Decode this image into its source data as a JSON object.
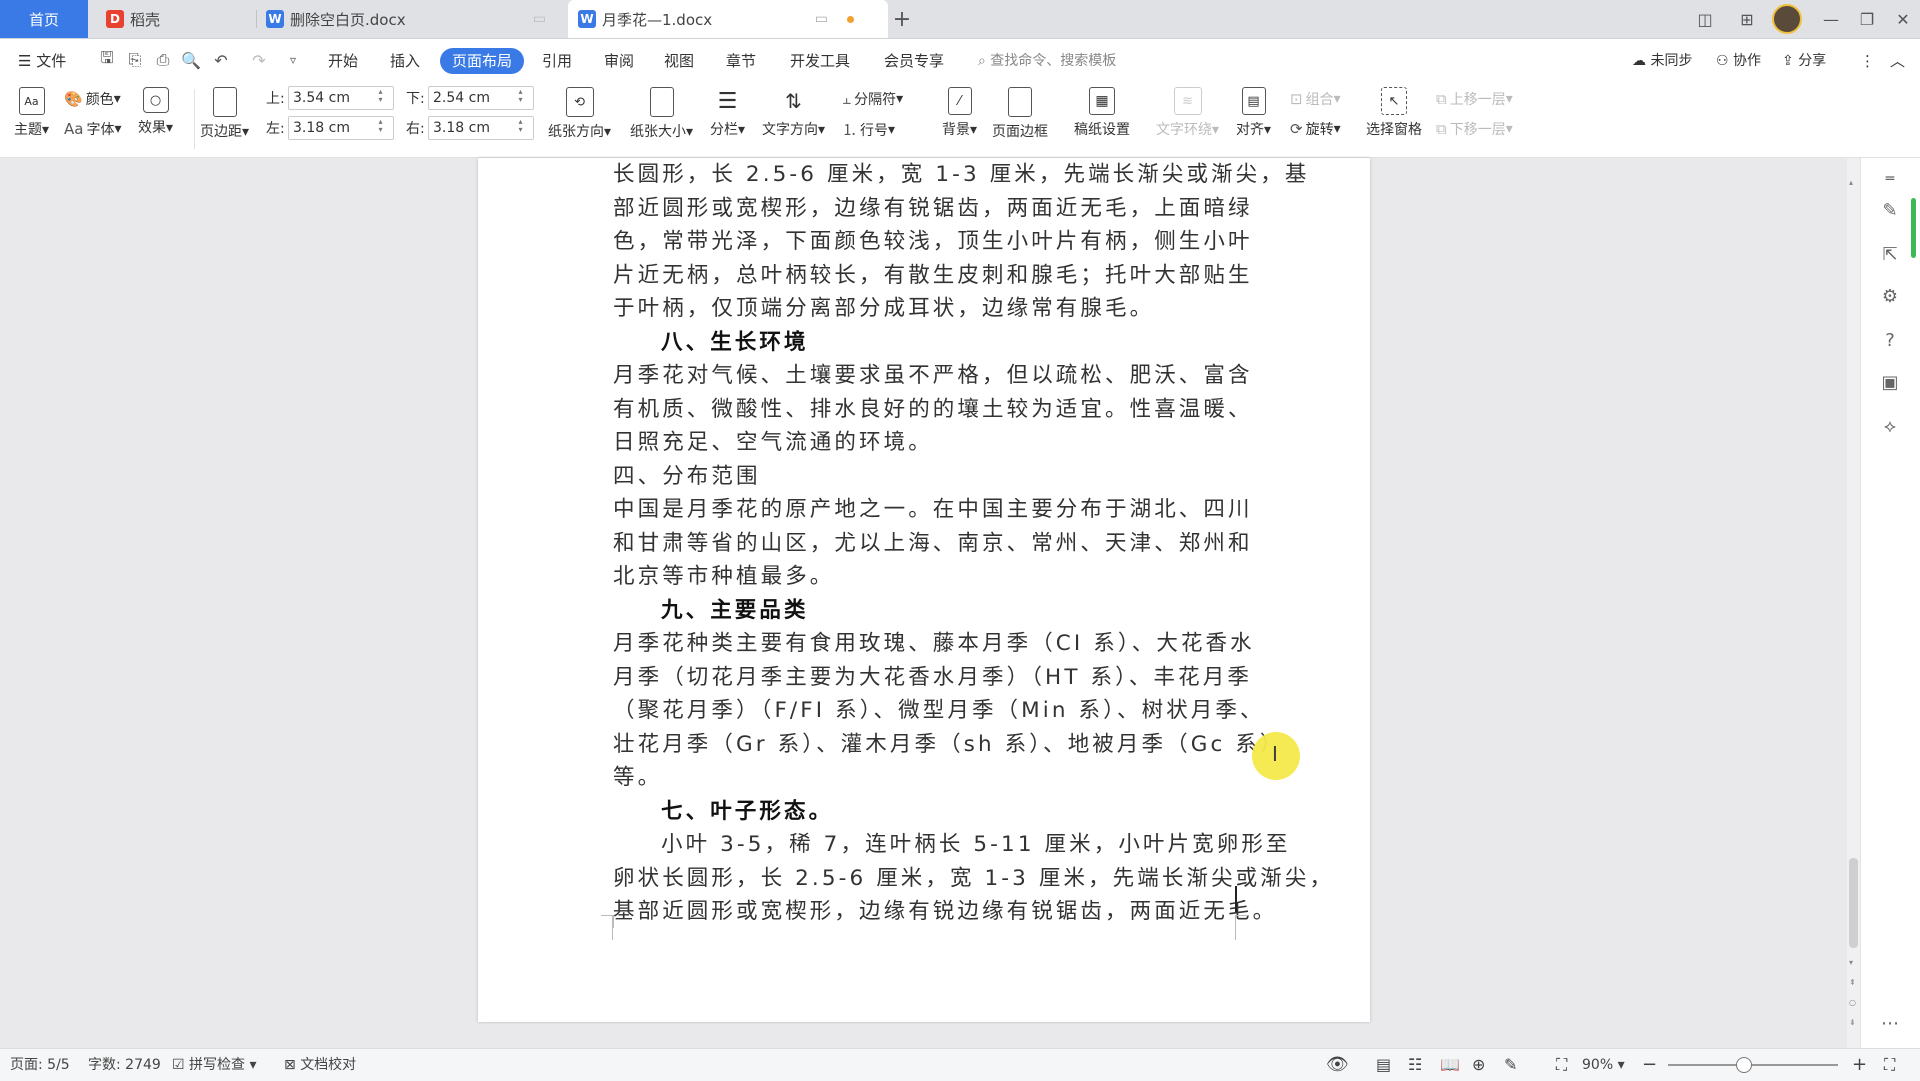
{
  "tabs": {
    "home": "首页",
    "daoke": "稻壳",
    "doc1": "删除空白页.docx",
    "doc2": "月季花—1.docx",
    "add": "+"
  },
  "menu": {
    "file": "文件",
    "items": [
      "开始",
      "插入",
      "页面布局",
      "引用",
      "审阅",
      "视图",
      "章节",
      "开发工具",
      "会员专享"
    ],
    "search_placeholder": "查找命令、搜索模板",
    "sync": "未同步",
    "collab": "协作",
    "share": "分享"
  },
  "ribbon": {
    "theme": "主题",
    "color": "颜色",
    "font": "字体",
    "effect": "效果",
    "margins": "页边距",
    "top_label": "上:",
    "top_value": "3.54 cm",
    "bottom_label": "下:",
    "bottom_value": "2.54 cm",
    "left_label": "左:",
    "left_value": "3.18 cm",
    "right_label": "右:",
    "right_value": "3.18 cm",
    "orientation": "纸张方向",
    "size": "纸张大小",
    "columns": "分栏",
    "text_direction": "文字方向",
    "breaks": "分隔符",
    "line_numbers": "行号",
    "background": "背景",
    "page_border": "页面边框",
    "manuscript": "稿纸设置",
    "wrap": "文字环绕",
    "align": "对齐",
    "group": "组合",
    "rotate": "旋转",
    "selection_pane": "选择窗格",
    "bring_forward": "上移一层",
    "send_backward": "下移一层"
  },
  "document": {
    "lines": [
      {
        "t": "长圆形，长 2.5-6 厘米，宽 1-3 厘米，先端长渐尖或渐尖，基",
        "cls": ""
      },
      {
        "t": "部近圆形或宽楔形，边缘有锐锯齿，两面近无毛，上面暗绿",
        "cls": ""
      },
      {
        "t": "色，常带光泽，下面颜色较浅，顶生小叶片有柄，侧生小叶",
        "cls": ""
      },
      {
        "t": "片近无柄，总叶柄较长，有散生皮刺和腺毛；托叶大部贴生",
        "cls": ""
      },
      {
        "t": "于叶柄，仅顶端分离部分成耳状，边缘常有腺毛。",
        "cls": ""
      },
      {
        "t": "八、生长环境",
        "cls": "hd"
      },
      {
        "t": "月季花对气候、土壤要求虽不严格，但以疏松、肥沃、富含",
        "cls": ""
      },
      {
        "t": "有机质、微酸性、排水良好的的壤土较为适宜。性喜温暖、",
        "cls": ""
      },
      {
        "t": "日照充足、空气流通的环境。",
        "cls": ""
      },
      {
        "t": "四、分布范围",
        "cls": ""
      },
      {
        "t": "中国是月季花的原产地之一。在中国主要分布于湖北、四川",
        "cls": ""
      },
      {
        "t": "和甘肃等省的山区，尤以上海、南京、常州、天津、郑州和",
        "cls": ""
      },
      {
        "t": "北京等市种植最多。",
        "cls": ""
      },
      {
        "t": "九、主要品类",
        "cls": "hd"
      },
      {
        "t": "月季花种类主要有食用玫瑰、藤本月季（CI 系）、大花香水",
        "cls": ""
      },
      {
        "t": "月季（切花月季主要为大花香水月季）（HT 系）、丰花月季",
        "cls": ""
      },
      {
        "t": "（聚花月季）（F/FI 系）、微型月季（Min 系）、树状月季、",
        "cls": ""
      },
      {
        "t": "壮花月季（Gr 系）、灌木月季（sh 系）、地被月季（Gc 系）",
        "cls": ""
      },
      {
        "t": "等。",
        "cls": ""
      },
      {
        "t": "七、叶子形态。",
        "cls": "hd"
      },
      {
        "t": "小叶 3-5，稀 7，连叶柄长 5-11 厘米，小叶片宽卵形至",
        "cls": "ind"
      },
      {
        "t": "卵状长圆形，长 2.5-6 厘米，宽 1-3 厘米，先端长渐尖或渐尖，",
        "cls": ""
      },
      {
        "t": "基部近圆形或宽楔形，边缘有锐边缘有锐锯齿，两面近无毛。",
        "cls": ""
      }
    ]
  },
  "status": {
    "page": "页面: 5/5",
    "words": "字数: 2749",
    "spell": "拼写检查",
    "proof": "文档校对",
    "zoom": "90%"
  }
}
